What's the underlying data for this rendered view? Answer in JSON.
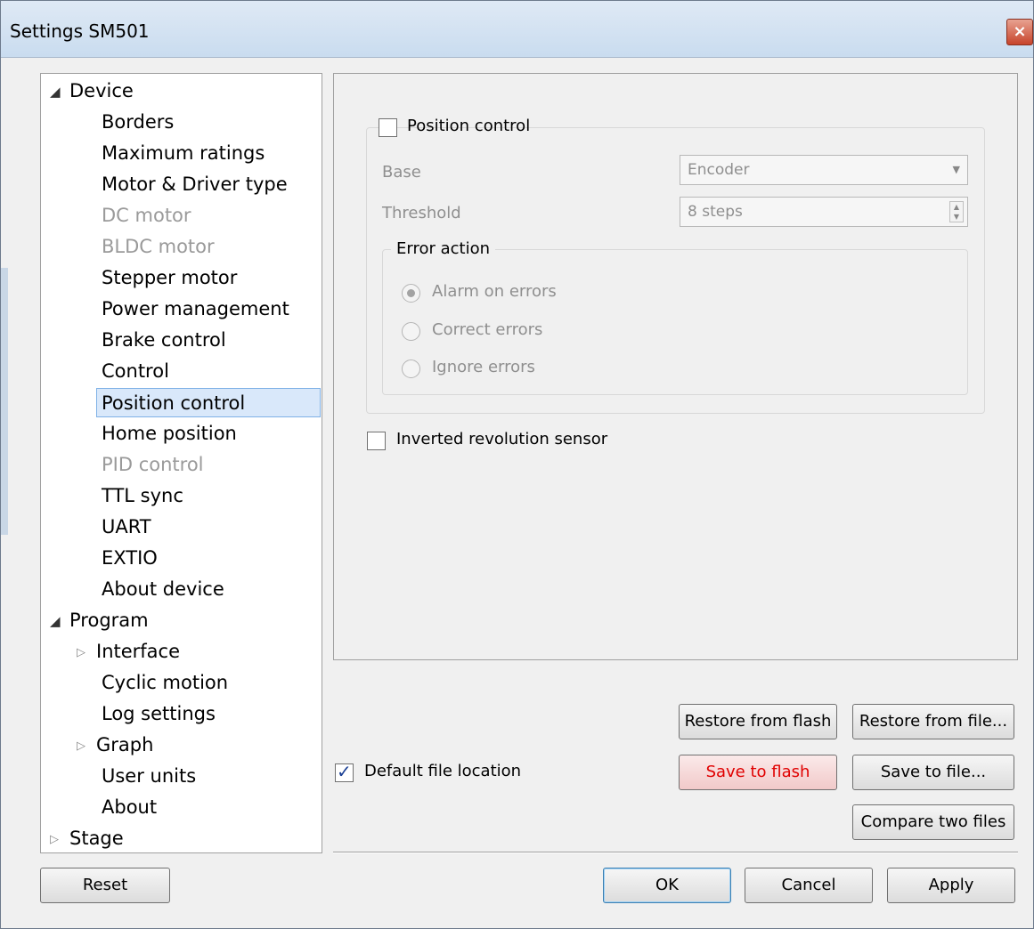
{
  "window": {
    "title": "Settings SM501",
    "close_icon": "×"
  },
  "tree": {
    "nodes": [
      {
        "label": "Device",
        "level": 0,
        "arrow": "open"
      },
      {
        "label": "Borders",
        "level": 1
      },
      {
        "label": "Maximum ratings",
        "level": 1
      },
      {
        "label": "Motor & Driver type",
        "level": 1
      },
      {
        "label": "DC motor",
        "level": 1,
        "disabled": true
      },
      {
        "label": "BLDC motor",
        "level": 1,
        "disabled": true
      },
      {
        "label": "Stepper motor",
        "level": 1
      },
      {
        "label": "Power management",
        "level": 1
      },
      {
        "label": "Brake control",
        "level": 1
      },
      {
        "label": "Control",
        "level": 1
      },
      {
        "label": "Position control",
        "level": 1,
        "selected": true
      },
      {
        "label": "Home position",
        "level": 1
      },
      {
        "label": "PID control",
        "level": 1,
        "disabled": true
      },
      {
        "label": "TTL sync",
        "level": 1
      },
      {
        "label": "UART",
        "level": 1
      },
      {
        "label": "EXTIO",
        "level": 1
      },
      {
        "label": "About device",
        "level": 1
      },
      {
        "label": "Program",
        "level": 0,
        "arrow": "open"
      },
      {
        "label": "Interface",
        "level": 1,
        "arrow": "closed"
      },
      {
        "label": "Cyclic motion",
        "level": 1
      },
      {
        "label": "Log settings",
        "level": 1
      },
      {
        "label": "Graph",
        "level": 1,
        "arrow": "closed"
      },
      {
        "label": "User units",
        "level": 1
      },
      {
        "label": "About",
        "level": 1
      },
      {
        "label": "Stage",
        "level": 0,
        "arrow": "closed"
      }
    ]
  },
  "position_control": {
    "checkbox_label": "Position control",
    "checked": false,
    "base_label": "Base",
    "base_value": "Encoder",
    "threshold_label": "Threshold",
    "threshold_value": "8 steps",
    "error_action_title": "Error action",
    "radios": [
      {
        "label": "Alarm on errors",
        "selected": true
      },
      {
        "label": "Correct errors",
        "selected": false
      },
      {
        "label": "Ignore errors",
        "selected": false
      }
    ]
  },
  "inverted_sensor": {
    "label": "Inverted revolution sensor",
    "checked": false
  },
  "default_location": {
    "label": "Default file location",
    "checked": true
  },
  "buttons": {
    "restore_flash": "Restore from flash",
    "restore_file": "Restore from file...",
    "save_flash": "Save to flash",
    "save_file": "Save to file...",
    "compare": "Compare two files",
    "reset": "Reset",
    "ok": "OK",
    "cancel": "Cancel",
    "apply": "Apply"
  },
  "colors": {
    "save_flash_text": "#e00000",
    "selection": "#d9e8fa"
  }
}
